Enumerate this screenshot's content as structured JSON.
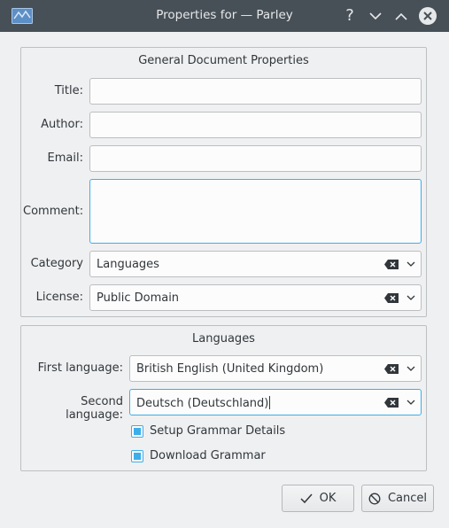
{
  "window": {
    "title": "Properties for  — Parley"
  },
  "general": {
    "group_title": "General Document Properties",
    "title_label": "Title:",
    "title_value": "",
    "author_label": "Author:",
    "author_value": "",
    "email_label": "Email:",
    "email_value": "",
    "comment_label": "Comment:",
    "comment_value": "",
    "category_label": "Category",
    "category_value": "Languages",
    "license_label": "License:",
    "license_value": "Public Domain"
  },
  "languages": {
    "group_title": "Languages",
    "first_label": "First language:",
    "first_value": "British English (United Kingdom)",
    "second_label": "Second language:",
    "second_value": "Deutsch (Deutschland)",
    "setup_grammar_label": "Setup Grammar Details",
    "setup_grammar_checked": true,
    "download_grammar_label": "Download Grammar",
    "download_grammar_checked": true
  },
  "buttons": {
    "ok": "OK",
    "cancel": "Cancel"
  },
  "colors": {
    "accent": "#3daee9",
    "titlebar": "#475057",
    "background": "#eff0f1"
  }
}
